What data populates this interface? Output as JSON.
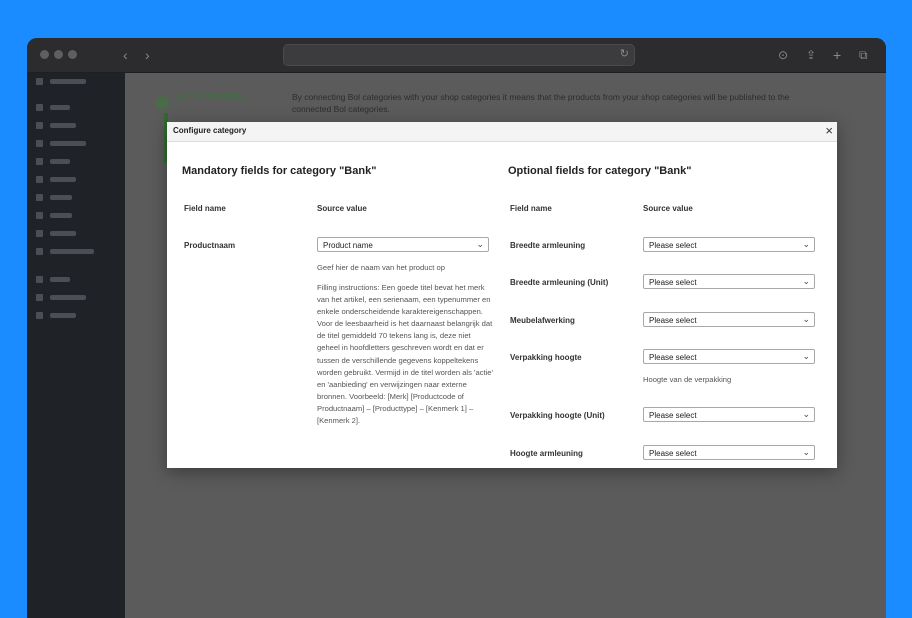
{
  "colors": {
    "background": "#1a8cff",
    "accent_green": "#2f8f2f"
  },
  "browser": {
    "traffic_lights": [
      "dot-1",
      "dot-2",
      "dot-3"
    ],
    "icons": [
      "back-icon",
      "forward-icon",
      "reload-icon",
      "download-icon",
      "share-icon",
      "new-tab-icon",
      "tabs-icon"
    ]
  },
  "background_page": {
    "nav_label": "AUTHORIZATION",
    "intro_text": "By connecting Bol categories with your shop categories it means that the products from your shop categories will be published to the connected Bol categories."
  },
  "modal": {
    "title": "Configure category",
    "close_label": "×",
    "mandatory": {
      "heading": "Mandatory fields for category \"Bank\"",
      "col_field": "Field name",
      "col_source": "Source value",
      "rows": [
        {
          "name": "Productnaam",
          "value": "Product name",
          "hint": "Geef hier de naam van het product op",
          "instructions": "Filling instructions: Een goede titel bevat het merk van het artikel, een serienaam, een typenummer en enkele onderscheidende karaktereigenschappen. Voor de leesbaarheid is het daarnaast belangrijk dat de titel gemiddeld 70 tekens lang is, deze niet geheel in hoofdletters geschreven wordt en dat er tussen de verschillende gegevens koppeltekens worden gebruikt. Vermijd in de titel worden als 'actie' en 'aanbieding' en verwijzingen naar externe bronnen. Voorbeeld: [Merk] [Productcode of Productnaam] – [Producttype] – [Kenmerk 1] – [Kenmerk 2]."
        }
      ]
    },
    "optional": {
      "heading": "Optional fields for category \"Bank\"",
      "col_field": "Field name",
      "col_source": "Source value",
      "rows": [
        {
          "name": "Breedte armleuning",
          "value": "Please select"
        },
        {
          "name": "Breedte armleuning (Unit)",
          "value": "Please select"
        },
        {
          "name": "Meubelafwerking",
          "value": "Please select"
        },
        {
          "name": "Verpakking hoogte",
          "value": "Please select",
          "hint": "Hoogte van de verpakking"
        },
        {
          "name": "Verpakking hoogte (Unit)",
          "value": "Please select"
        },
        {
          "name": "Hoogte armleuning",
          "value": "Please select"
        }
      ]
    }
  }
}
